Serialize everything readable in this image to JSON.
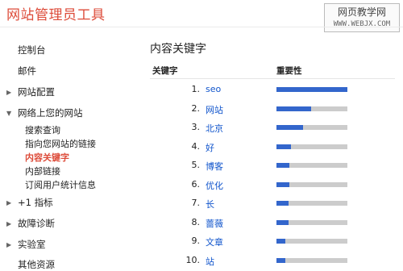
{
  "app": {
    "title": "网站管理员工具"
  },
  "watermark": {
    "line1": "网页教学网",
    "line2": "WWW.WEBJX.COM"
  },
  "colors": {
    "accent_red": "#dd4b39",
    "link_blue": "#1155cc",
    "bar_fill": "#3366cc",
    "bar_track": "#cccccc"
  },
  "sidebar": {
    "items": [
      {
        "label": "控制台",
        "arrow": ""
      },
      {
        "label": "邮件",
        "arrow": ""
      },
      {
        "label": "网站配置",
        "arrow": "collapsed"
      },
      {
        "label": "网络上您的网站",
        "arrow": "expanded"
      },
      {
        "label": "+1 指标",
        "arrow": "collapsed"
      },
      {
        "label": "故障诊断",
        "arrow": "collapsed"
      },
      {
        "label": "实验室",
        "arrow": "collapsed"
      },
      {
        "label": "其他资源",
        "arrow": ""
      }
    ],
    "subitems": [
      {
        "label": "搜索查询"
      },
      {
        "label": "指向您网站的链接"
      },
      {
        "label": "内容关键字",
        "active": true
      },
      {
        "label": "内部链接"
      },
      {
        "label": "订阅用户统计信息"
      }
    ]
  },
  "main": {
    "title": "内容关键字",
    "col_keyword": "关键字",
    "col_importance": "重要性",
    "rows": [
      {
        "num": "1.",
        "keyword": "seo",
        "importance": 1.0
      },
      {
        "num": "2.",
        "keyword": "网站",
        "importance": 0.49
      },
      {
        "num": "3.",
        "keyword": "北京",
        "importance": 0.38
      },
      {
        "num": "4.",
        "keyword": "好",
        "importance": 0.21
      },
      {
        "num": "5.",
        "keyword": "博客",
        "importance": 0.18
      },
      {
        "num": "6.",
        "keyword": "优化",
        "importance": 0.18
      },
      {
        "num": "7.",
        "keyword": "长",
        "importance": 0.17
      },
      {
        "num": "8.",
        "keyword": "蔷薇",
        "importance": 0.17
      },
      {
        "num": "9.",
        "keyword": "文章",
        "importance": 0.13
      },
      {
        "num": "10.",
        "keyword": "站",
        "importance": 0.13
      }
    ]
  }
}
